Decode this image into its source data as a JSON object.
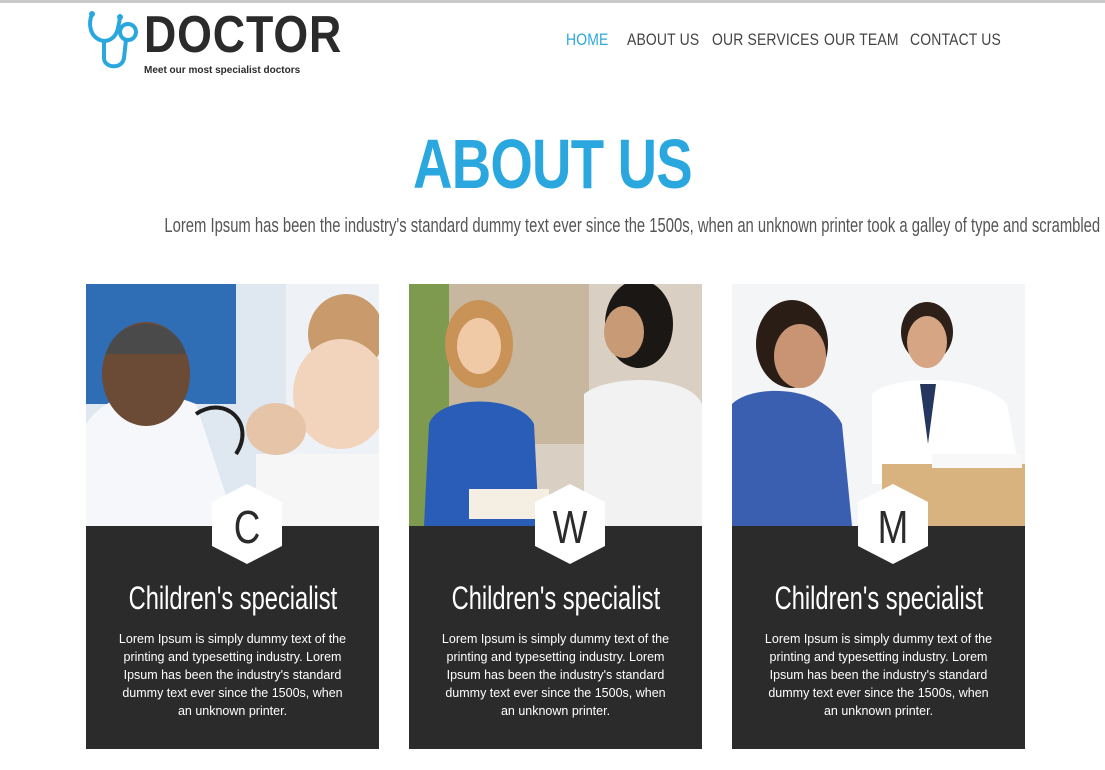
{
  "header": {
    "brand": "DOCTOR",
    "tagline": "Meet our most specialist doctors",
    "nav": [
      "HOME",
      "ABOUT US",
      "OUR SERVICES",
      "OUR TEAM",
      "CONTACT US"
    ],
    "active_nav": "HOME"
  },
  "about": {
    "title": "ABOUT US",
    "text": "Lorem Ipsum has been the industry's standard dummy text ever since the 1500s, when an unknown printer took a galley of type and scrambled"
  },
  "cards": [
    {
      "letter": "C",
      "title": "Children's specialist",
      "text": "Lorem Ipsum is simply dummy text of the printing and typesetting industry. Lorem Ipsum has been the industry's standard dummy text ever since the 1500s, when an unknown printer."
    },
    {
      "letter": "W",
      "title": "Children's specialist",
      "text": "Lorem Ipsum is simply dummy text of the printing and typesetting industry. Lorem Ipsum has been the industry's standard dummy text ever since the 1500s, when an unknown printer."
    },
    {
      "letter": "M",
      "title": "Children's specialist",
      "text": "Lorem Ipsum is simply dummy text of the printing and typesetting industry. Lorem Ipsum has been the industry's standard dummy text ever since the 1500s, when an unknown printer."
    }
  ],
  "colors": {
    "accent": "#2aa7de",
    "card_bg": "#2b2b2b",
    "text_dark": "#2b2b2b"
  },
  "icons": {
    "logo": "stethoscope-icon"
  }
}
